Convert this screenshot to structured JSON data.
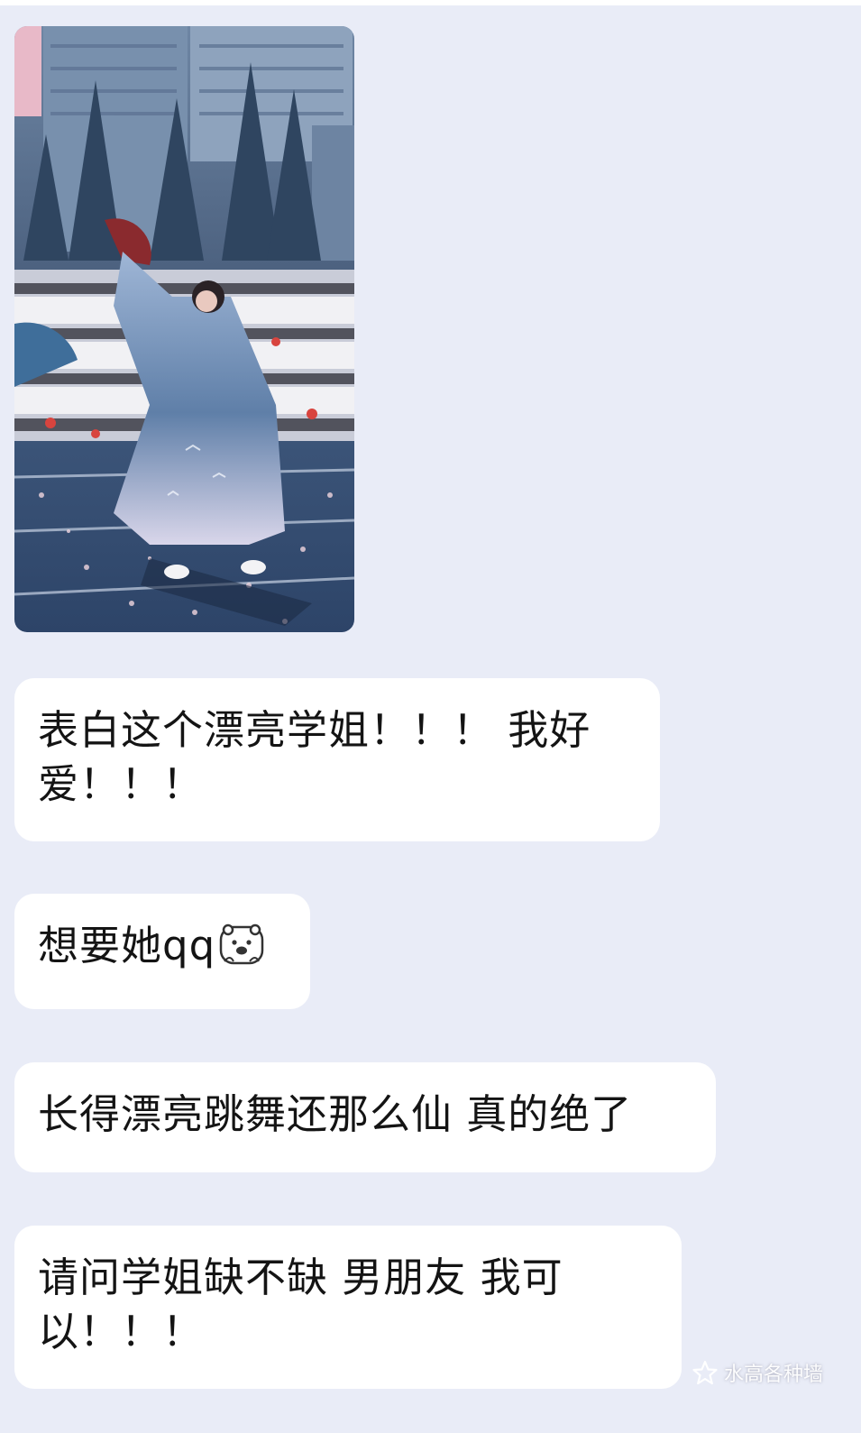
{
  "messages": [
    {
      "text": "表白这个漂亮学姐！！！ 我好爱！！！"
    },
    {
      "text": "想要她qq",
      "emoji": "bear-face"
    },
    {
      "text": "长得漂亮跳舞还那么仙 真的绝了"
    },
    {
      "text": "请问学姐缺不缺 男朋友 我可以！！！"
    }
  ],
  "photo": {
    "description_icon": "dancer-photo"
  },
  "watermark": {
    "text": "水高各种墙",
    "icon": "star-logo-icon"
  },
  "colors": {
    "background": "#e9ecf7",
    "bubble": "#ffffff",
    "text": "#141414"
  }
}
